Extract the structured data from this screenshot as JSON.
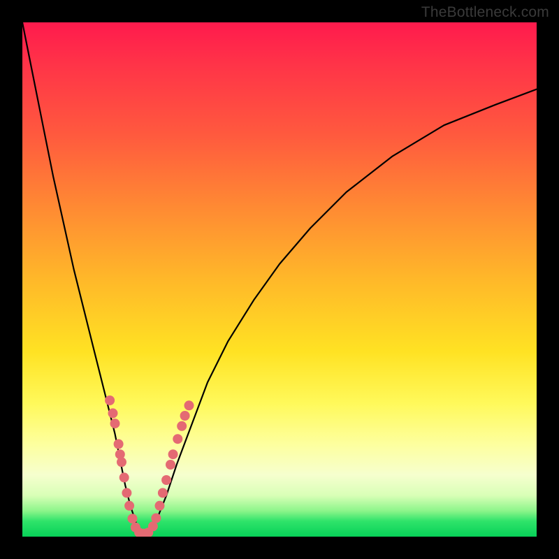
{
  "watermark": "TheBottleneck.com",
  "colors": {
    "frame": "#000000",
    "curve_stroke": "#000000",
    "marker_fill": "#e46a73",
    "marker_stroke": "#b84f57"
  },
  "chart_data": {
    "type": "line",
    "title": "",
    "xlabel": "",
    "ylabel": "",
    "xlim": [
      0,
      100
    ],
    "ylim": [
      0,
      100
    ],
    "note": "Axes unlabeled; values are percentages of plot width/height estimated from pixels. y increases upward (0 at bottom green band).",
    "series": [
      {
        "name": "bottleneck-curve",
        "x": [
          0,
          2,
          4,
          6,
          8,
          10,
          12,
          14,
          16,
          18,
          19,
          20,
          21,
          22,
          22.8,
          24.5,
          26,
          28,
          30,
          33,
          36,
          40,
          45,
          50,
          56,
          63,
          72,
          82,
          92,
          100
        ],
        "y": [
          100,
          90,
          80,
          70,
          61,
          52,
          44,
          36,
          28,
          20,
          15,
          10,
          6,
          3,
          0.5,
          0.5,
          3,
          8,
          14,
          22,
          30,
          38,
          46,
          53,
          60,
          67,
          74,
          80,
          84,
          87
        ]
      }
    ],
    "markers": {
      "name": "highlighted-points",
      "note": "Clustered salmon-colored dots on both arms near the valley; counts/positions estimated",
      "points": [
        {
          "x": 17.0,
          "y": 26.5
        },
        {
          "x": 17.6,
          "y": 24.0
        },
        {
          "x": 18.0,
          "y": 22.0
        },
        {
          "x": 18.7,
          "y": 18.0
        },
        {
          "x": 19.0,
          "y": 16.0
        },
        {
          "x": 19.3,
          "y": 14.5
        },
        {
          "x": 19.8,
          "y": 11.5
        },
        {
          "x": 20.3,
          "y": 8.5
        },
        {
          "x": 20.8,
          "y": 6.0
        },
        {
          "x": 21.4,
          "y": 3.5
        },
        {
          "x": 22.0,
          "y": 1.8
        },
        {
          "x": 22.7,
          "y": 0.8
        },
        {
          "x": 23.6,
          "y": 0.6
        },
        {
          "x": 24.5,
          "y": 0.8
        },
        {
          "x": 25.4,
          "y": 2.0
        },
        {
          "x": 26.0,
          "y": 3.6
        },
        {
          "x": 26.7,
          "y": 6.0
        },
        {
          "x": 27.3,
          "y": 8.5
        },
        {
          "x": 28.0,
          "y": 11.0
        },
        {
          "x": 28.8,
          "y": 14.0
        },
        {
          "x": 29.3,
          "y": 16.0
        },
        {
          "x": 30.2,
          "y": 19.0
        },
        {
          "x": 31.0,
          "y": 21.5
        },
        {
          "x": 31.6,
          "y": 23.5
        },
        {
          "x": 32.4,
          "y": 25.5
        }
      ]
    },
    "background_gradient_stops": [
      {
        "pos": 0.0,
        "color": "#ff1a4d"
      },
      {
        "pos": 0.22,
        "color": "#ff5a3e"
      },
      {
        "pos": 0.5,
        "color": "#ffb829"
      },
      {
        "pos": 0.74,
        "color": "#fff95a"
      },
      {
        "pos": 0.92,
        "color": "#d9ffb7"
      },
      {
        "pos": 1.0,
        "color": "#07d158"
      }
    ]
  }
}
